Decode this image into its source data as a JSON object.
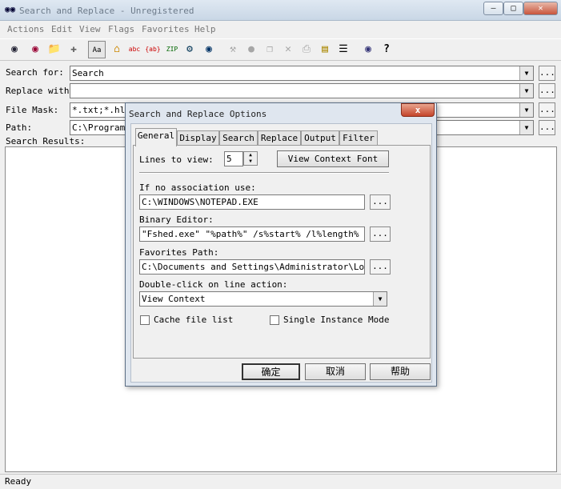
{
  "window": {
    "title": "Search and Replace - Unregistered"
  },
  "menu": [
    "Actions",
    "Edit",
    "View",
    "Flags",
    "Favorites",
    "Help"
  ],
  "toolbar_icons": [
    "binoculars-icon",
    "binoculars-red-icon",
    "open-icon",
    "move-icon",
    "case-icon",
    "house-icon",
    "abc-icon",
    "ab-icon",
    "zip-icon",
    "network-icon",
    "ie-icon",
    "tools-icon",
    "globe-icon",
    "copy-icon",
    "delete-icon",
    "print-icon",
    "notepad-icon",
    "list-icon",
    "binoculars-small-icon",
    "help-icon"
  ],
  "form": {
    "search_label": "Search for:",
    "search_value": "Search",
    "replace_label": "Replace with:",
    "replace_value": "",
    "mask_label": "File Mask:",
    "mask_value": "*.txt;*.hlp",
    "path_label": "Path:",
    "path_value": "C:\\Program",
    "results_label": "Search Results:",
    "browse": "..."
  },
  "status": "Ready",
  "dialog": {
    "title": "Search and Replace Options",
    "close": "x",
    "tabs": [
      "General",
      "Display",
      "Search",
      "Replace",
      "Output",
      "Filter"
    ],
    "lines_label": "Lines to view:",
    "lines_value": "5",
    "view_font_button": "View Context Font",
    "assoc_label": "If no association use:",
    "assoc_value": "C:\\WINDOWS\\NOTEPAD.EXE",
    "binary_label": "Binary Editor:",
    "binary_value": "\"Fshed.exe\" \"%path%\" /s%start% /l%length%",
    "fav_label": "Favorites Path:",
    "fav_value": "C:\\Documents and Settings\\Administrator\\Local S",
    "dblclick_label": "Double-click on line action:",
    "dblclick_value": "View Context",
    "cache_label": "Cache file list",
    "single_label": "Single Instance Mode",
    "ok": "确定",
    "cancel": "取消",
    "help": "帮助",
    "browse": "..."
  }
}
